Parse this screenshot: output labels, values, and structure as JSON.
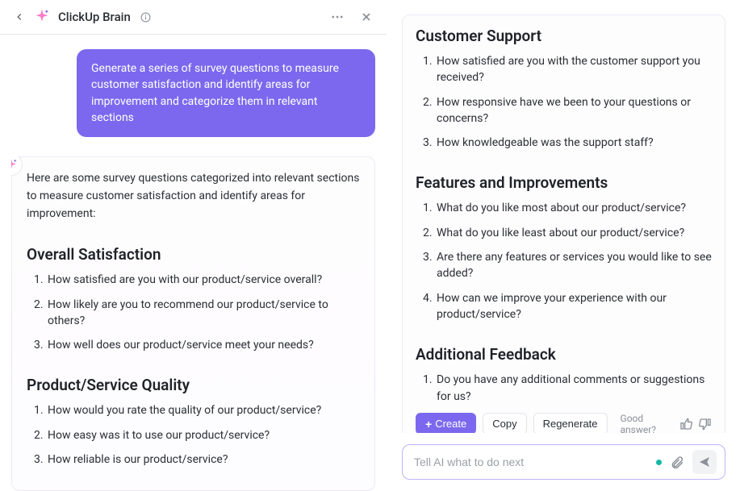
{
  "header": {
    "title": "ClickUp Brain"
  },
  "prompt": "Generate a series of survey questions to measure customer satisfaction and identify areas for improvement and categorize them in relevant sections",
  "response": {
    "intro": "Here are some survey questions categorized into relevant sections to measure customer satisfaction and identify areas for improvement:",
    "left_sections": [
      {
        "title": "Overall Satisfaction",
        "questions": [
          "How satisfied are you with our product/service overall?",
          "How likely are you to recommend our product/service to others?",
          "How well does our product/service meet your needs?"
        ]
      },
      {
        "title": "Product/Service Quality",
        "questions": [
          "How would you rate the quality of our product/service?",
          "How easy was it to use our product/service?",
          "How reliable is our product/service?"
        ]
      }
    ],
    "right_sections": [
      {
        "title": "Customer Support",
        "questions": [
          "How satisfied are you with the customer support you received?",
          "How responsive have we been to your questions or concerns?",
          "How knowledgeable was the support staff?"
        ]
      },
      {
        "title": "Features and Improvements",
        "questions": [
          "What do you like most about our product/service?",
          "What do you like least about our product/service?",
          "Are there any features or services you would like to see added?",
          "How can we improve your experience with our product/service?"
        ]
      },
      {
        "title": "Additional Feedback",
        "questions": [
          "Do you have any additional comments or suggestions for us?"
        ]
      }
    ]
  },
  "actions": {
    "create": "Create",
    "copy": "Copy",
    "regenerate": "Regenerate",
    "good_answer": "Good answer?"
  },
  "input": {
    "placeholder": "Tell AI what to do next"
  }
}
